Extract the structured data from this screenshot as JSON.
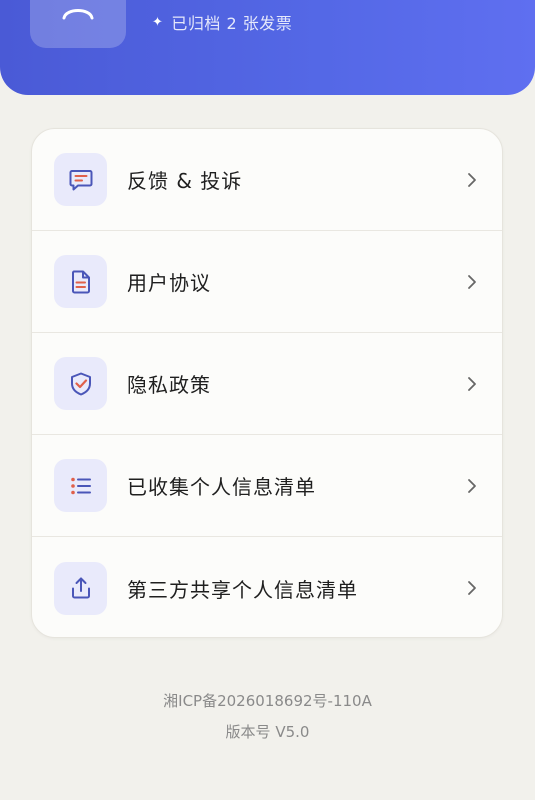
{
  "header": {
    "archived_text": "已归档 2 张发票",
    "accent": "#5262e0"
  },
  "menu": {
    "items": [
      {
        "label": "反馈 & 投诉",
        "icon": "feedback-icon"
      },
      {
        "label": "用户协议",
        "icon": "document-icon"
      },
      {
        "label": "隐私政策",
        "icon": "shield-check-icon"
      },
      {
        "label": "已收集个人信息清单",
        "icon": "list-icon"
      },
      {
        "label": "第三方共享个人信息清单",
        "icon": "share-upload-icon"
      }
    ]
  },
  "footer": {
    "icp": "湘ICP备2026018692号-110A",
    "version": "版本号 V5.0"
  }
}
